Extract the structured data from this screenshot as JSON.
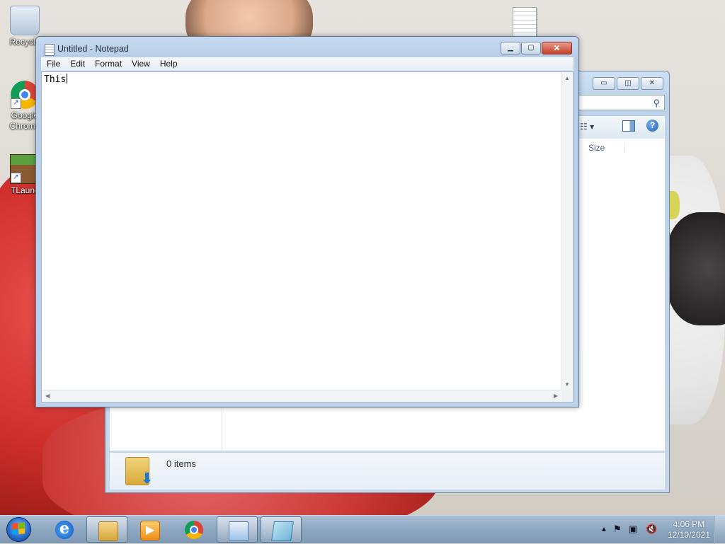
{
  "desktop": {
    "icons": [
      {
        "label": "Recycle"
      },
      {
        "label": "Google Chrome"
      },
      {
        "label": "TLaunc"
      }
    ]
  },
  "explorer": {
    "column_header": "Size",
    "status_text": "0 items",
    "controls": {
      "minimize": "▭",
      "restore": "◫",
      "close": "✕"
    }
  },
  "notepad": {
    "title": "Untitled - Notepad",
    "menu": [
      "File",
      "Edit",
      "Format",
      "View",
      "Help"
    ],
    "content": "This",
    "controls": {
      "minimize": "▁",
      "maximize": "▢",
      "close": "✕"
    }
  },
  "taskbar": {
    "items": [
      {
        "name": "internet-explorer",
        "icon": "ie-icon"
      },
      {
        "name": "windows-explorer",
        "icon": "folder-icon"
      },
      {
        "name": "windows-media-player",
        "icon": "media-player-icon"
      },
      {
        "name": "google-chrome",
        "icon": "chrome-icon"
      },
      {
        "name": "control-panel",
        "icon": "control-panel-icon"
      },
      {
        "name": "notepad",
        "icon": "notepad-icon"
      }
    ],
    "clock": {
      "time": "4:06 PM",
      "date": "12/19/2021"
    }
  },
  "colors": {
    "accent": "#1a5fb4",
    "close_red": "#c3402a"
  }
}
